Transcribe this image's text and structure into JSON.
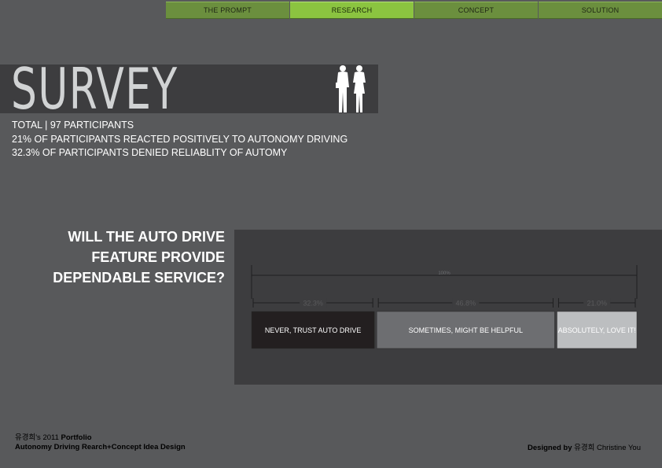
{
  "nav": {
    "tabs": [
      {
        "label": "THE PROMPT",
        "active": false
      },
      {
        "label": "RESEARCH",
        "active": true
      },
      {
        "label": "CONCEPT",
        "active": false
      },
      {
        "label": "SOLUTION",
        "active": false
      }
    ]
  },
  "header": {
    "title": "SURVEY",
    "icon": "business-people-icon"
  },
  "stats": [
    "TOTAL | 97 PARTICIPANTS",
    "21% OF PARTICIPANTS REACTED POSITIVELY TO AUTONOMY DRIVING",
    "32.3% OF PARTICIPANTS DENIED RELIABLITY OF AUTOMY"
  ],
  "question": {
    "line1": "WILL THE AUTO DRIVE",
    "line2": "FEATURE PROVIDE",
    "line3": "DEPENDABLE SERVICE?"
  },
  "chart_data": {
    "type": "bar",
    "orientation": "horizontal-stacked",
    "total_label": "100%",
    "categories": [
      "NEVER, TRUST AUTO DRIVE",
      "SOMETIMES, MIGHT BE HELPFUL",
      "ABSOLUTELY, LOVE IT!"
    ],
    "values": [
      32.3,
      46.8,
      21.0
    ],
    "value_labels": [
      "32.3%",
      "46.8%",
      "21.0%"
    ],
    "colors": [
      "#231f20",
      "#6d6e71",
      "#bcbec0"
    ],
    "label_colors": [
      "#ffffff",
      "#ffffff",
      "#ffffff"
    ]
  },
  "footer": {
    "left_line1_name": "유경희",
    "left_line1_rest": "'s 2011 ",
    "left_line1_bold": "Portfolio",
    "left_line2": "Autonomy Driving Rearch+Concept Idea Design",
    "right_bold": "Designed by",
    "right_rest": " 유경희 Christine You"
  }
}
